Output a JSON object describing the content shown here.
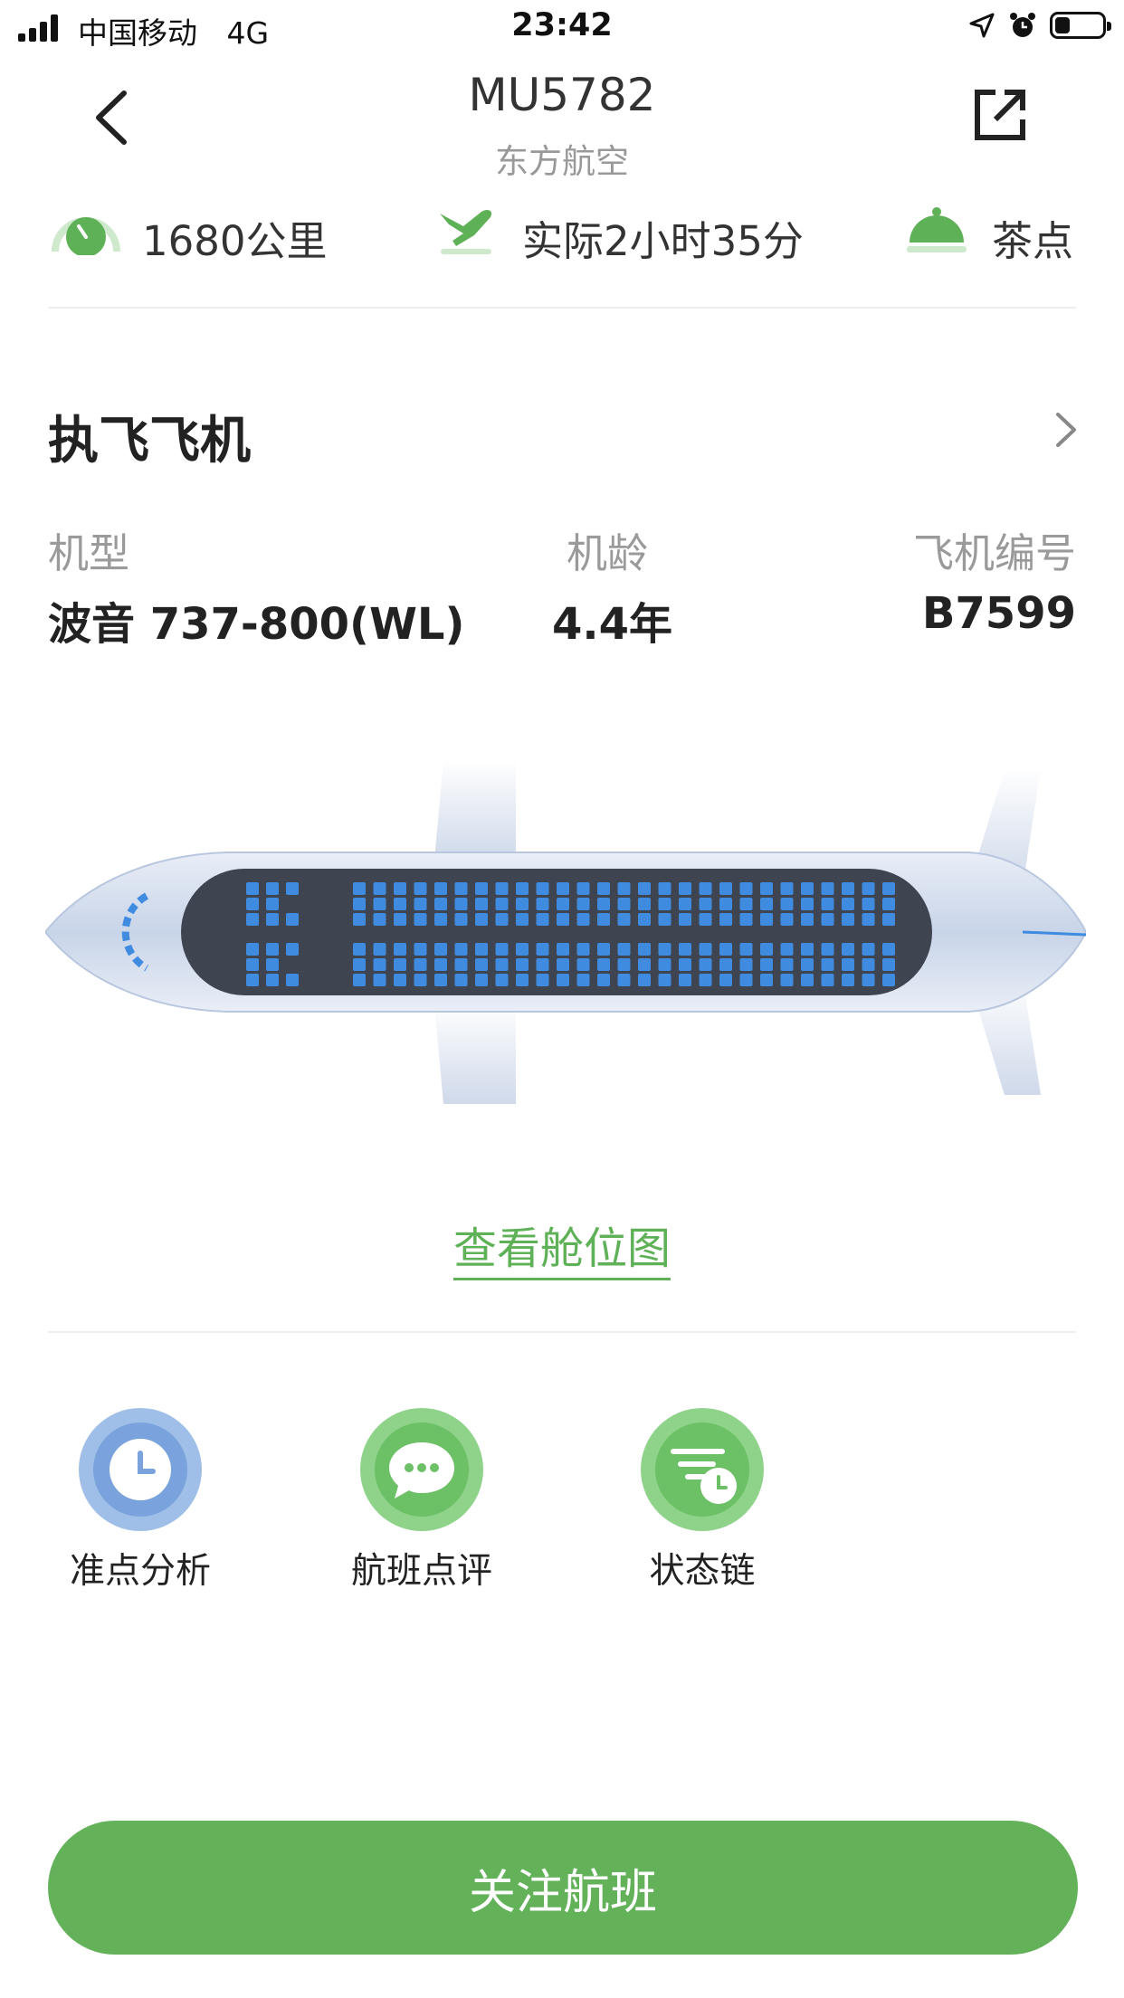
{
  "status_bar": {
    "carrier": "中国移动",
    "network": "4G",
    "time": "23:42"
  },
  "nav": {
    "title": "MU5782",
    "subtitle": "东方航空"
  },
  "info": {
    "distance": "1680公里",
    "duration": "实际2小时35分",
    "meal": "茶点"
  },
  "aircraft": {
    "section_title": "执飞飞机",
    "type_label": "机型",
    "type_value": "波音 737-800(WL)",
    "age_label": "机龄",
    "age_value": "4.4年",
    "reg_label": "飞机编号",
    "reg_value": "B7599",
    "seat_map_link": "查看舱位图"
  },
  "functions": [
    {
      "label": "准点分析",
      "icon": "clock-icon"
    },
    {
      "label": "航班点评",
      "icon": "chat-bubble-icon"
    },
    {
      "label": "状态链",
      "icon": "status-chain-icon"
    }
  ],
  "follow_button": "关注航班",
  "colors": {
    "accent": "#63b25a",
    "link": "#5fb157",
    "seat": "#3f8be0",
    "cabin": "#3f4451"
  }
}
